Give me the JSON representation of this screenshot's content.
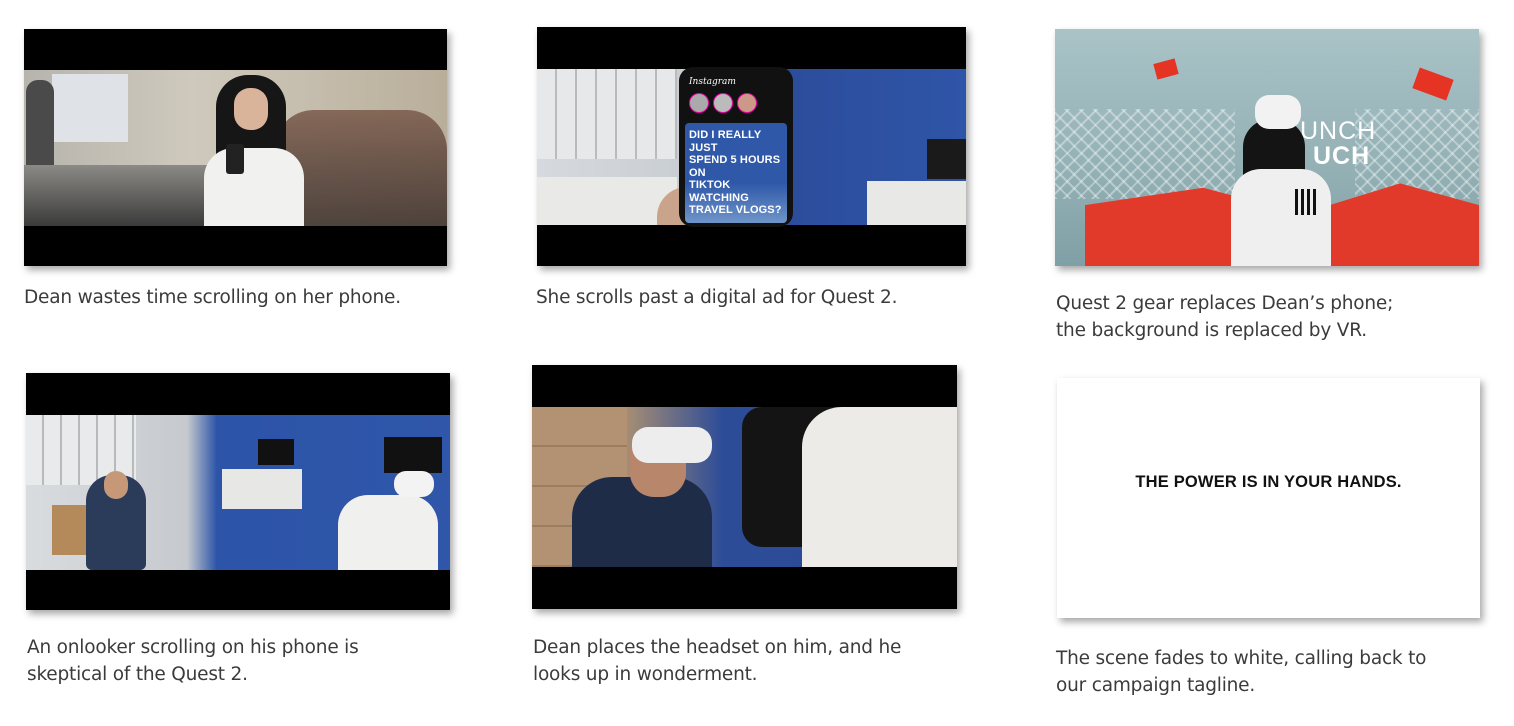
{
  "frames": [
    {
      "caption_lines": [
        "Dean wastes time scrolling on her phone."
      ]
    },
    {
      "caption_lines": [
        "She scrolls past a digital ad for Quest 2."
      ],
      "phone_app": "Instagram",
      "post_text": [
        "DID I REALLY JUST",
        "SPEND 5 HOURS ON",
        "TIKTOK WATCHING",
        "TRAVEL VLOGS?"
      ]
    },
    {
      "caption_lines": [
        "Quest 2 gear replaces Dean’s phone;",
        "the background is replaced by VR."
      ],
      "vr_words": [
        "UNCH",
        "UCH"
      ]
    },
    {
      "caption_lines": [
        "An onlooker scrolling on his phone is",
        "skeptical of the Quest 2."
      ]
    },
    {
      "caption_lines": [
        "Dean places the headset on him, and he",
        "looks up in wonderment."
      ]
    },
    {
      "caption_lines": [
        "The scene fades to white, calling back to",
        "our campaign tagline."
      ],
      "tagline": "THE POWER IS IN YOUR HANDS."
    }
  ]
}
